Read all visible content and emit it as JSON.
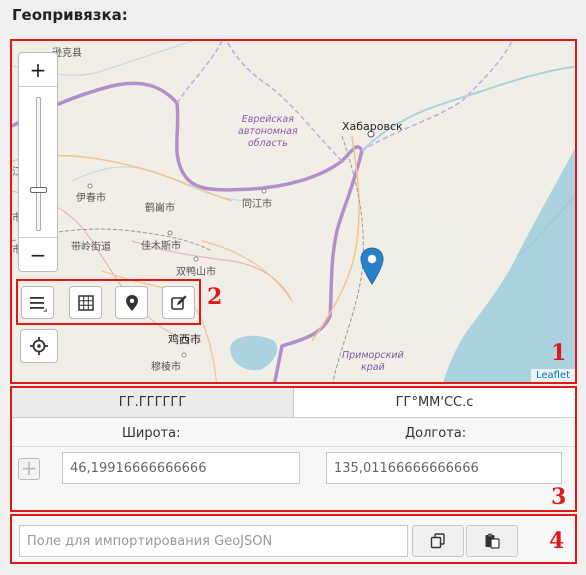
{
  "heading": "Геопривязка:",
  "annotations": [
    "1",
    "2",
    "3",
    "4"
  ],
  "map": {
    "zoom_in": "+",
    "zoom_out": "−",
    "zoom_level_fraction": 0.62,
    "attribution": "Leaflet",
    "labels": {
      "xunke": "逊克县",
      "yichun": "伊春市",
      "hegang": "鹤岗市",
      "tongjiang": "同江市",
      "jiamusi": "佳木斯市",
      "tanghe": "带岭街道",
      "shuangyashan": "双鸭山市",
      "jixi": "鸡西市",
      "muling": "穆棱市",
      "khabarovsk": "Хабаровск",
      "edge1": "江市",
      "edge2": "市",
      "edge3": "市",
      "jewish_region": "Еврейская\nавтономная\nобласть",
      "primorsky": "Приморский\nкрай"
    },
    "toolbar_icons": [
      "menu-icon",
      "grid-icon",
      "map-pin-icon",
      "edit-icon",
      "crosshair-icon"
    ]
  },
  "coords": {
    "tab_decimal": "ГГ.ГГГГГГ",
    "tab_dms": "ГГ°ММ'СС.с",
    "lat_label": "Широта:",
    "lon_label": "Долгота:",
    "add_button": "+",
    "lat_value": "46,19916666666666",
    "lon_value": "135,01166666666666"
  },
  "import": {
    "placeholder": "Поле для импортирования GeoJSON"
  },
  "colors": {
    "annotation_red": "#e01818",
    "marker_blue": "#2a81cb",
    "sea": "#aad3df",
    "border_purple": "#b28fcb"
  }
}
